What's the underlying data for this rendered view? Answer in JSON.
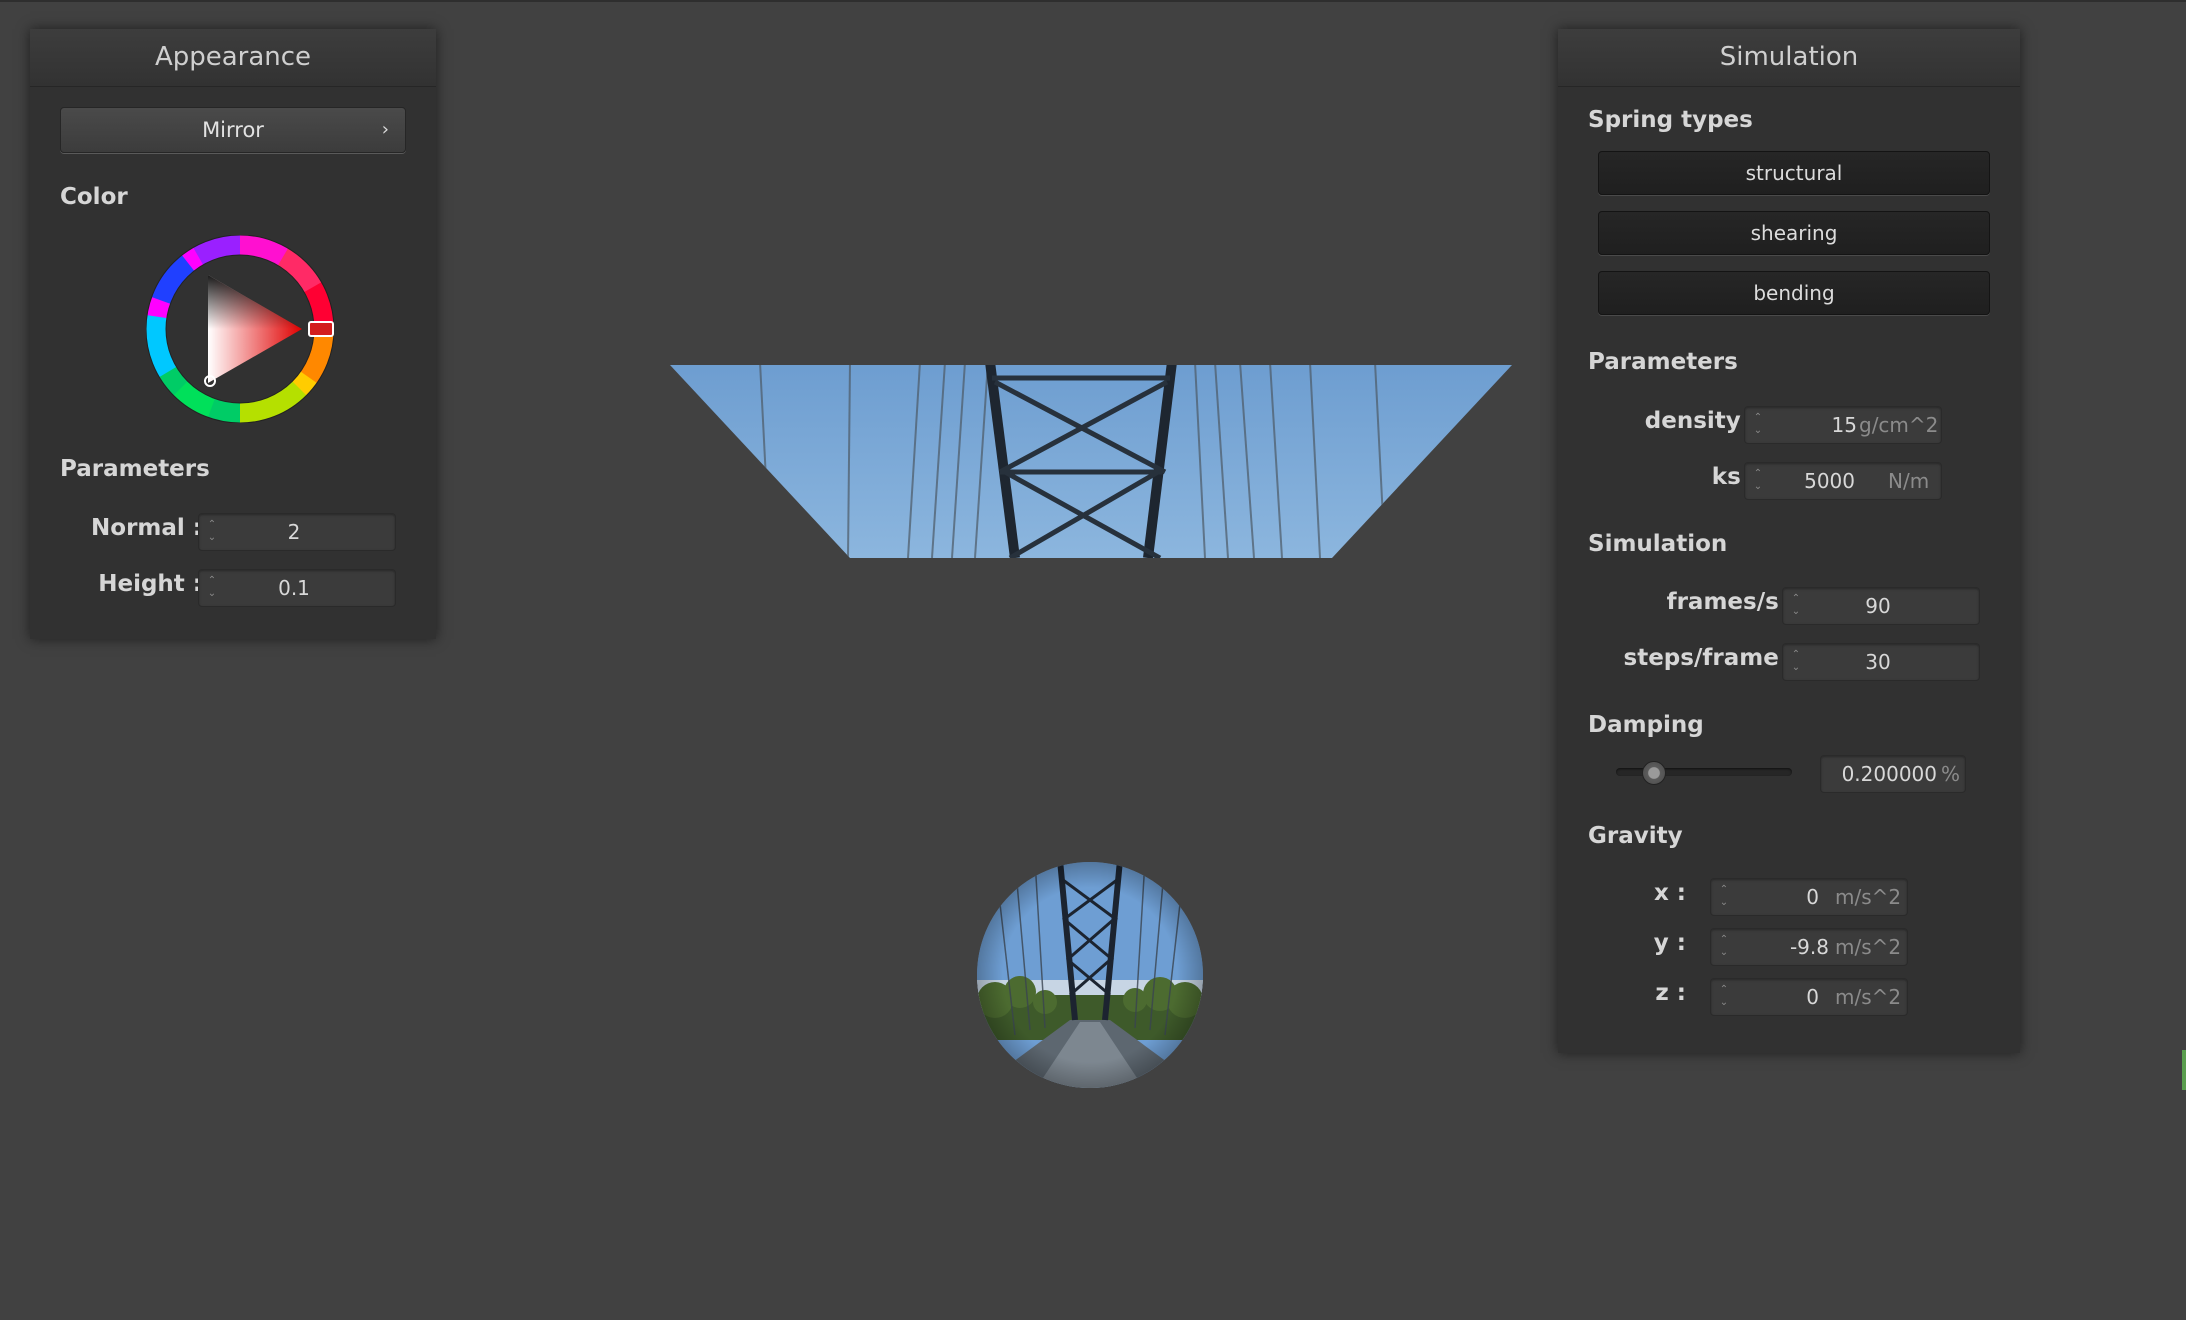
{
  "appearance": {
    "title": "Appearance",
    "shader_button": "Mirror",
    "color_label": "Color",
    "selected_color": "#c21f1f",
    "parameters_label": "Parameters",
    "normal_label": "Normal :",
    "normal_value": "2",
    "height_label": "Height :",
    "height_value": "0.1"
  },
  "simulation": {
    "title": "Simulation",
    "spring_types_label": "Spring types",
    "spring_types": [
      "structural",
      "shearing",
      "bending"
    ],
    "parameters_label": "Parameters",
    "density_label": "density :",
    "density_value": "15",
    "density_unit": "g/cm^2",
    "ks_label": "ks :",
    "ks_value": "5000",
    "ks_unit": "N/m",
    "simulation_label": "Simulation",
    "fps_label": "frames/s :",
    "fps_value": "90",
    "steps_label": "steps/frame :",
    "steps_value": "30",
    "damping_label": "Damping",
    "damping_value": "0.200000",
    "damping_unit": "%",
    "damping_fraction": 0.2,
    "gravity_label": "Gravity",
    "gx_label": "x :",
    "gx_value": "0",
    "gy_label": "y :",
    "gy_value": "-9.8",
    "gz_label": "z :",
    "gz_value": "0",
    "gravity_unit": "m/s^2"
  },
  "colors": {
    "background": "#414141",
    "panel": "#313131",
    "sky": "#6f9fcf"
  },
  "icons": {
    "chevron": "chevron-right-icon",
    "spinner": "spinner-arrows-icon"
  }
}
